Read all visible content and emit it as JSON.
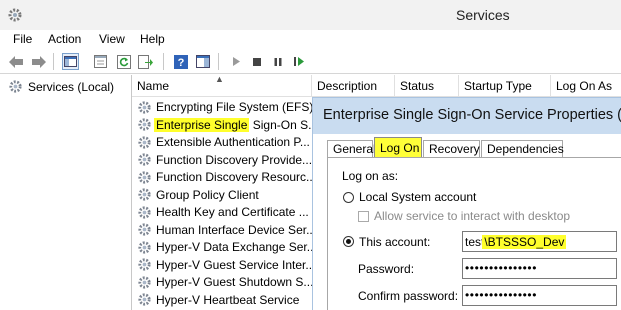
{
  "window": {
    "title": "Services"
  },
  "menu": {
    "file": "File",
    "action": "Action",
    "view": "View",
    "help": "Help"
  },
  "toolbar": {
    "icons": [
      "back-arrow-icon",
      "forward-arrow-icon",
      "console-tree-icon",
      "properties-icon",
      "refresh-icon",
      "export-list-icon",
      "help-icon",
      "show-hide-icon",
      "play-icon",
      "stop-icon",
      "pause-icon",
      "restart-icon"
    ]
  },
  "tree": {
    "root_label": "Services (Local)"
  },
  "columns": {
    "name": "Name",
    "description": "Description",
    "status": "Status",
    "startup_type": "Startup Type",
    "log_on_as": "Log On As"
  },
  "services": [
    {
      "name": "Encrypting File System (EFS)"
    },
    {
      "name_hl": "Enterprise Single",
      "name_rest": " Sign-On S..."
    },
    {
      "name": "Extensible Authentication P..."
    },
    {
      "name": "Function Discovery Provide..."
    },
    {
      "name": "Function Discovery Resourc..."
    },
    {
      "name": "Group Policy Client"
    },
    {
      "name": "Health Key and Certificate ..."
    },
    {
      "name": "Human Interface Device Ser..."
    },
    {
      "name": "Hyper-V Data Exchange Ser..."
    },
    {
      "name": "Hyper-V Guest Service Inter..."
    },
    {
      "name": "Hyper-V Guest Shutdown S..."
    },
    {
      "name": "Hyper-V Heartbeat Service"
    }
  ],
  "dialog": {
    "title": "Enterprise Single Sign-On Service Properties (",
    "tabs": {
      "general": "General",
      "log_on": "Log On",
      "recovery": "Recovery",
      "dependencies": "Dependencies"
    },
    "log_on_as_label": "Log on as:",
    "local_system_label": "Local System account",
    "allow_interact_label": "Allow service to interact with desktop",
    "this_account_label": "This account:",
    "account_value_prefix": "test",
    "account_value_hl": "\\BTSSSO_Dev",
    "password_label": "Password:",
    "password_value": "•••••••••••••••",
    "confirm_password_label": "Confirm password:",
    "confirm_password_value": "•••••••••••••••"
  },
  "colors": {
    "highlight": "#ffff2c",
    "dialog_title_bg": "#c9dcf0"
  }
}
